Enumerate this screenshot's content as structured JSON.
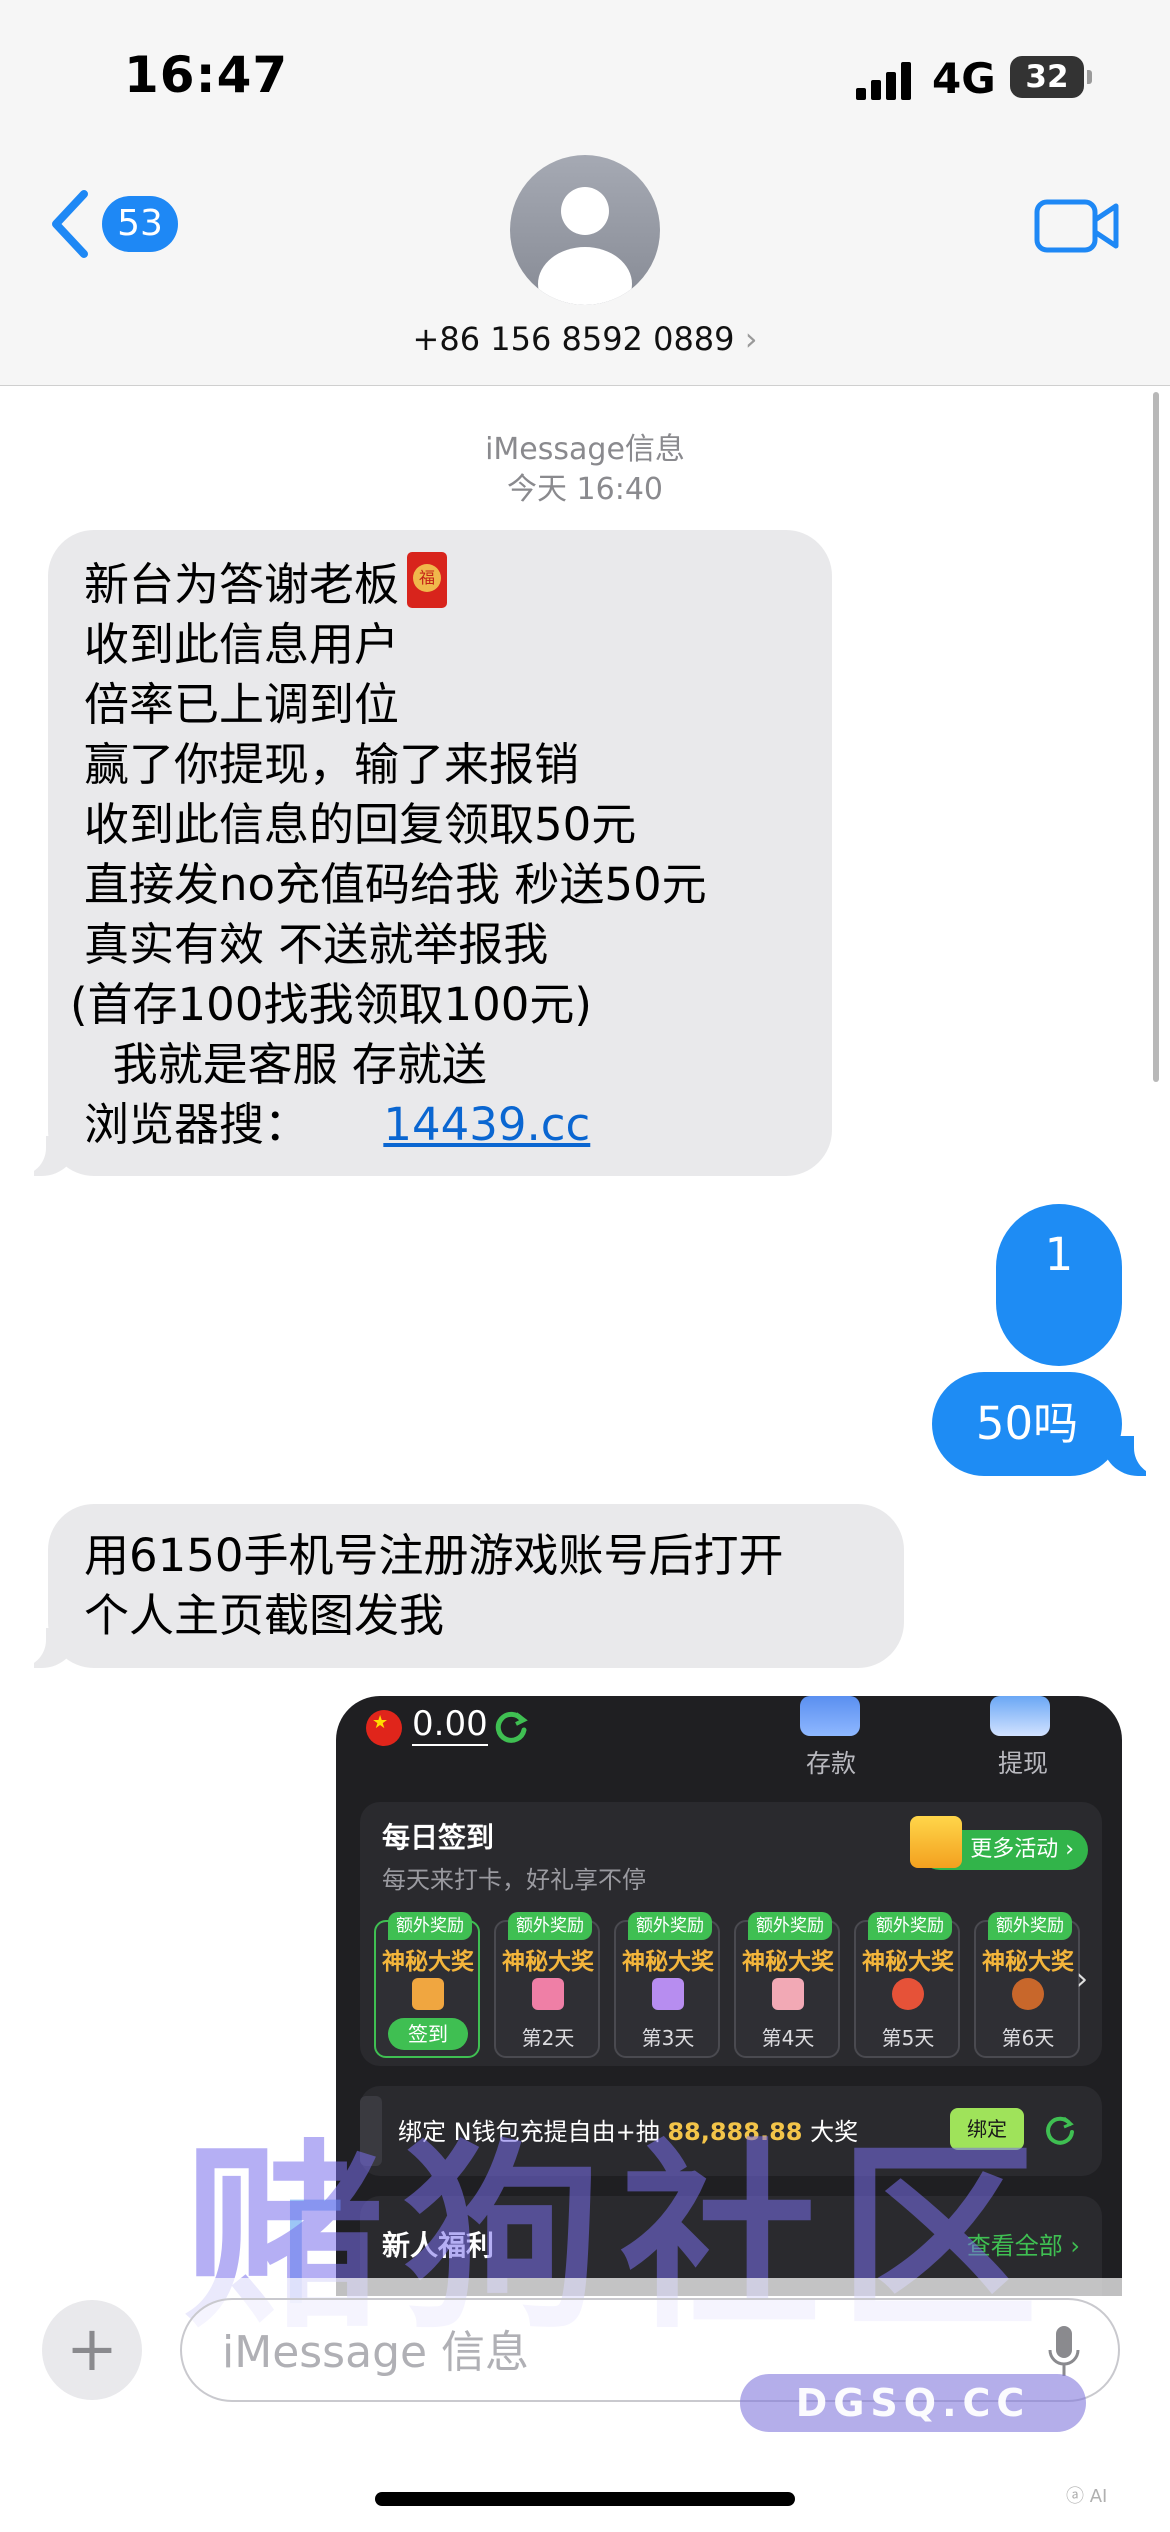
{
  "status_bar": {
    "time": "16:47",
    "network": "4G",
    "battery": "32"
  },
  "header": {
    "back_count": "53",
    "contact": "+86 156 8592 0889",
    "contact_chevron": "›"
  },
  "thread": {
    "service": "iMessage信息",
    "timestamp": "今天 16:40",
    "messages": [
      {
        "direction": "in",
        "lines": [
          "新台为答谢老板",
          "收到此信息用户",
          "倍率已上调到位",
          "赢了你提现，输了来报销",
          "收到此信息的回复领取50元",
          "直接发no充值码给我 秒送50元",
          "真实有效 不送就举报我",
          "(首存100找我领取100元)",
          "  我就是客服 存就送"
        ],
        "last_line_prefix": "浏览器搜：",
        "link": "14439.cc"
      },
      {
        "direction": "out",
        "text": "1"
      },
      {
        "direction": "out",
        "text": "50吗"
      },
      {
        "direction": "in",
        "lines": [
          "用6150手机号注册游戏账号后打开",
          "个人主页截图发我"
        ]
      }
    ]
  },
  "screenshot": {
    "balance": "0.00",
    "deposit": "存款",
    "withdraw": "提现",
    "checkin": {
      "title": "每日签到",
      "subtitle": "每天来打卡，好礼享不停",
      "more": "更多活动 ›",
      "days": [
        {
          "tag": "额外奖励",
          "prize": "神秘大奖",
          "label": "签到"
        },
        {
          "tag": "额外奖励",
          "prize": "神秘大奖",
          "label": "第2天"
        },
        {
          "tag": "额外奖励",
          "prize": "神秘大奖",
          "label": "第3天"
        },
        {
          "tag": "额外奖励",
          "prize": "神秘大奖",
          "label": "第4天"
        },
        {
          "tag": "额外奖励",
          "prize": "神秘大奖",
          "label": "第5天"
        },
        {
          "tag": "额外奖励",
          "prize": "神秘大奖",
          "label": "第6天"
        }
      ],
      "next": "›"
    },
    "bind": {
      "prefix": "绑定 N",
      "wallet": "钱包充提自由+抽",
      "amount": "88,888.88",
      "suffix": "大奖",
      "button": "绑定"
    },
    "newbie": {
      "title": "新人福利",
      "all": "查看全部 ›"
    }
  },
  "watermark": {
    "text": "赌狗社区",
    "url": "DGSQ.CC"
  },
  "compose": {
    "placeholder": "iMessage 信息",
    "plus": "+",
    "ai_tag": "ⓐ AI"
  },
  "colors": {
    "bubble_out": "#1e8cf4",
    "bubble_in": "#e9e9eb",
    "link": "#0a66d1",
    "accent_green": "#3fbf52"
  }
}
